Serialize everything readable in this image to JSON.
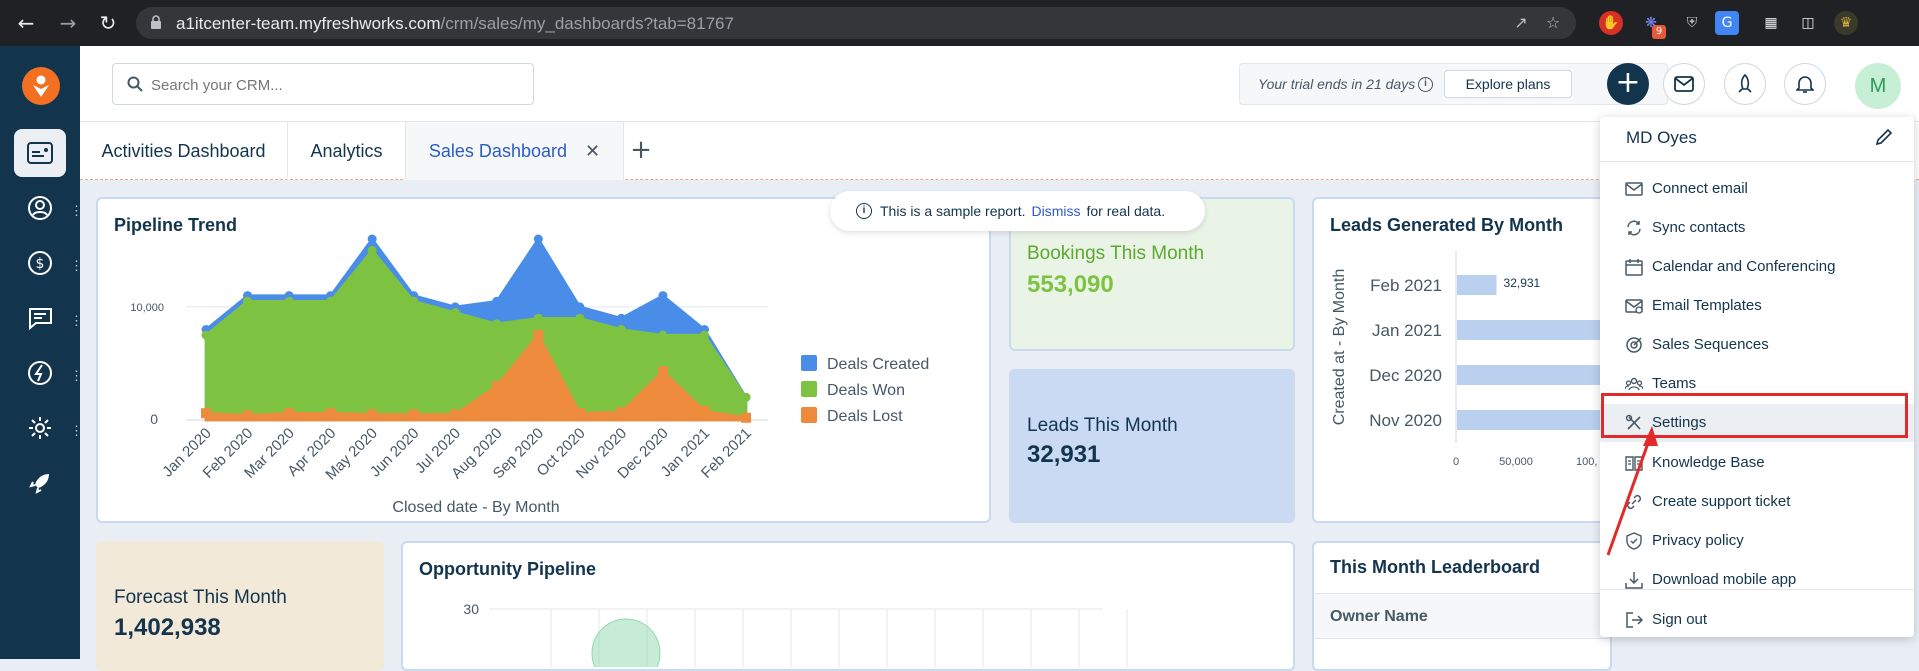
{
  "browser": {
    "url_host": "a1itcenter-team.myfreshworks.com",
    "url_path": "/crm/sales/my_dashboards?tab=81767",
    "ext_badge": "9"
  },
  "topbar": {
    "search_placeholder": "Search your CRM...",
    "trial_text": "Your trial ends in 21 days",
    "explore_label": "Explore plans",
    "avatar_initial": "M"
  },
  "tabs": [
    {
      "label": "Activities Dashboard"
    },
    {
      "label": "Analytics"
    },
    {
      "label": "Sales Dashboard"
    }
  ],
  "banner": {
    "before": "This is a sample report.",
    "dismiss": "Dismiss",
    "after": "for real data."
  },
  "cards": {
    "pipeline_title": "Pipeline Trend",
    "bookings_label": "Bookings This Month",
    "bookings_value": "553,090",
    "leads_label": "Leads This Month",
    "leads_value": "32,931",
    "leads_by_month_title": "Leads Generated By Month",
    "forecast_label": "Forecast This Month",
    "forecast_value": "1,402,938",
    "opportunity_title": "Opportunity Pipeline",
    "leaderboard_title": "This Month Leaderboard",
    "leaderboard_col": "Owner Name"
  },
  "chart_data": [
    {
      "type": "area",
      "title": "Pipeline Trend",
      "xlabel": "Closed date - By Month",
      "ylabel": "",
      "categories": [
        "Jan 2020",
        "Feb 2020",
        "Mar 2020",
        "Apr 2020",
        "May 2020",
        "Jun 2020",
        "Jul 2020",
        "Aug 2020",
        "Sep 2020",
        "Oct 2020",
        "Nov 2020",
        "Dec 2020",
        "Jan 2021",
        "Feb 2021"
      ],
      "yticks": [
        "10,000",
        "0"
      ],
      "ylim": [
        0,
        16000
      ],
      "series": [
        {
          "name": "Deals Created",
          "color": "#4a8de8",
          "values": [
            8000,
            11000,
            11000,
            11000,
            16000,
            11000,
            10000,
            10500,
            16000,
            10000,
            9000,
            11000,
            8000,
            2000
          ]
        },
        {
          "name": "Deals Won",
          "color": "#7dc241",
          "values": [
            7500,
            10500,
            10500,
            10500,
            15000,
            10500,
            9500,
            8500,
            9000,
            9000,
            8000,
            7500,
            7500,
            2000
          ]
        },
        {
          "name": "Deals Lost",
          "color": "#ee8a3b",
          "values": [
            600,
            400,
            600,
            600,
            500,
            500,
            500,
            3000,
            7500,
            600,
            700,
            4300,
            800,
            200
          ]
        }
      ]
    },
    {
      "type": "bar",
      "title": "Leads Generated By Month",
      "ylabel": "Created at - By Month",
      "categories": [
        "Feb 2021",
        "Jan 2021",
        "Dec 2020",
        "Nov 2020"
      ],
      "values": [
        32931,
        120000,
        120000,
        120000
      ],
      "data_labels": [
        "32,931"
      ],
      "xticks": [
        "0",
        "50,000",
        "100,"
      ],
      "color": "#b9d0ee"
    },
    {
      "type": "scatter",
      "title": "Opportunity Pipeline",
      "yticks": [
        "30"
      ],
      "color": "#8fd9ae"
    }
  ],
  "menu": {
    "user": "MD Oyes",
    "items": [
      {
        "label": "Connect email",
        "icon": "mail-icon"
      },
      {
        "label": "Sync contacts",
        "icon": "sync-icon"
      },
      {
        "label": "Calendar and Conferencing",
        "icon": "calendar-icon"
      },
      {
        "label": "Email Templates",
        "icon": "email-template-icon"
      },
      {
        "label": "Sales Sequences",
        "icon": "target-icon"
      },
      {
        "label": "Teams",
        "icon": "teams-icon"
      },
      {
        "label": "Settings",
        "icon": "settings-icon"
      },
      {
        "label": "Knowledge Base",
        "icon": "book-icon"
      },
      {
        "label": "Create support ticket",
        "icon": "link-icon"
      },
      {
        "label": "Privacy policy",
        "icon": "shield-icon"
      },
      {
        "label": "Download mobile app",
        "icon": "download-icon"
      },
      {
        "label": "Sign out",
        "icon": "sign-out-icon"
      }
    ]
  },
  "colors": {
    "sidebar": "#12344d",
    "accent_orange": "#f36f21",
    "link_blue": "#2c5cc5",
    "highlight_red": "#e32a2a",
    "bookings_green": "#7dc241"
  }
}
